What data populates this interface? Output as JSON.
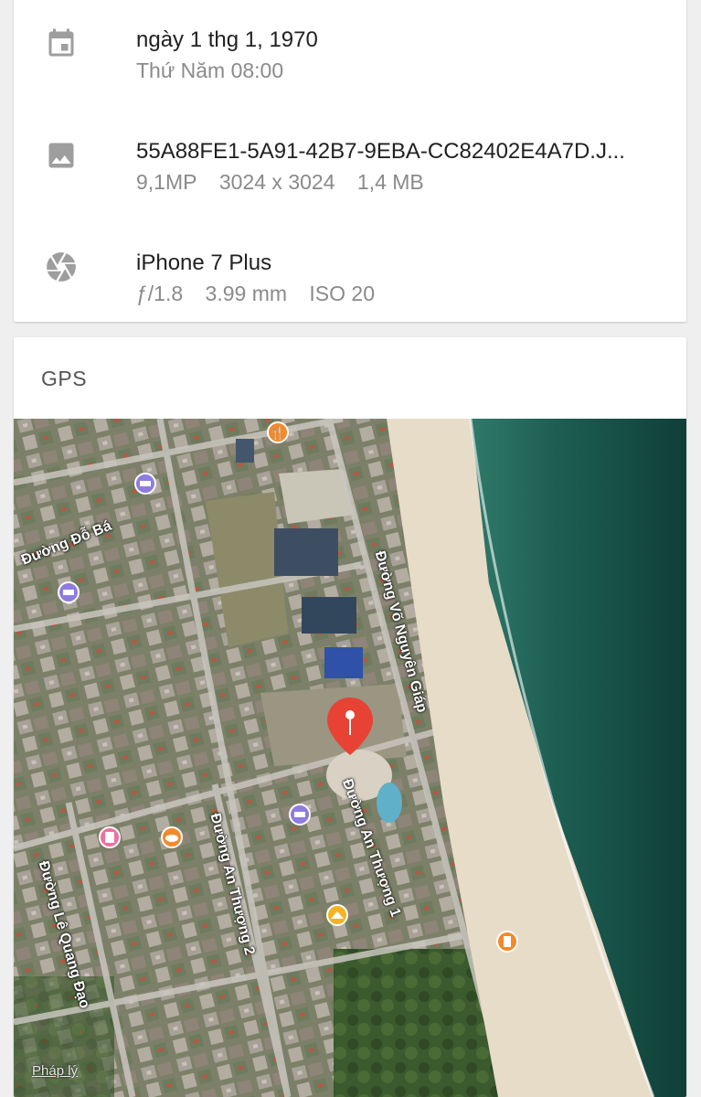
{
  "details": {
    "date": {
      "icon": "calendar-icon",
      "primary": "ngày 1 thg 1, 1970",
      "secondary": "Thứ Năm 08:00"
    },
    "file": {
      "icon": "image-icon",
      "primary": "55A88FE1-5A91-42B7-9EBA-CC82402E4A7D.J...",
      "megapixels": "9,1MP",
      "resolution": "3024 x 3024",
      "size": "1,4 MB"
    },
    "camera": {
      "icon": "camera-aperture-icon",
      "primary": "iPhone 7 Plus",
      "aperture": "ƒ/1.8",
      "focal_length": "3.99 mm",
      "iso": "ISO 20"
    }
  },
  "gps": {
    "title": "GPS",
    "map": {
      "streets": {
        "do_ba": "Đường Đỗ Bá",
        "vo_nguyen_giap": "Đường Võ Nguyên Giáp",
        "an_thuong_1": "Đường An Thượng 1",
        "an_thuong_2": "Đường An Thượng 2",
        "le_quang_dao": "Đường Lê Quang Đạo"
      },
      "legal_link": "Pháp lý",
      "pin_color": "#e84235",
      "poi_icons": [
        "restaurant-icon",
        "hotel-icon",
        "bakery-icon",
        "clothing-store-icon",
        "women-clothing-icon"
      ]
    }
  }
}
